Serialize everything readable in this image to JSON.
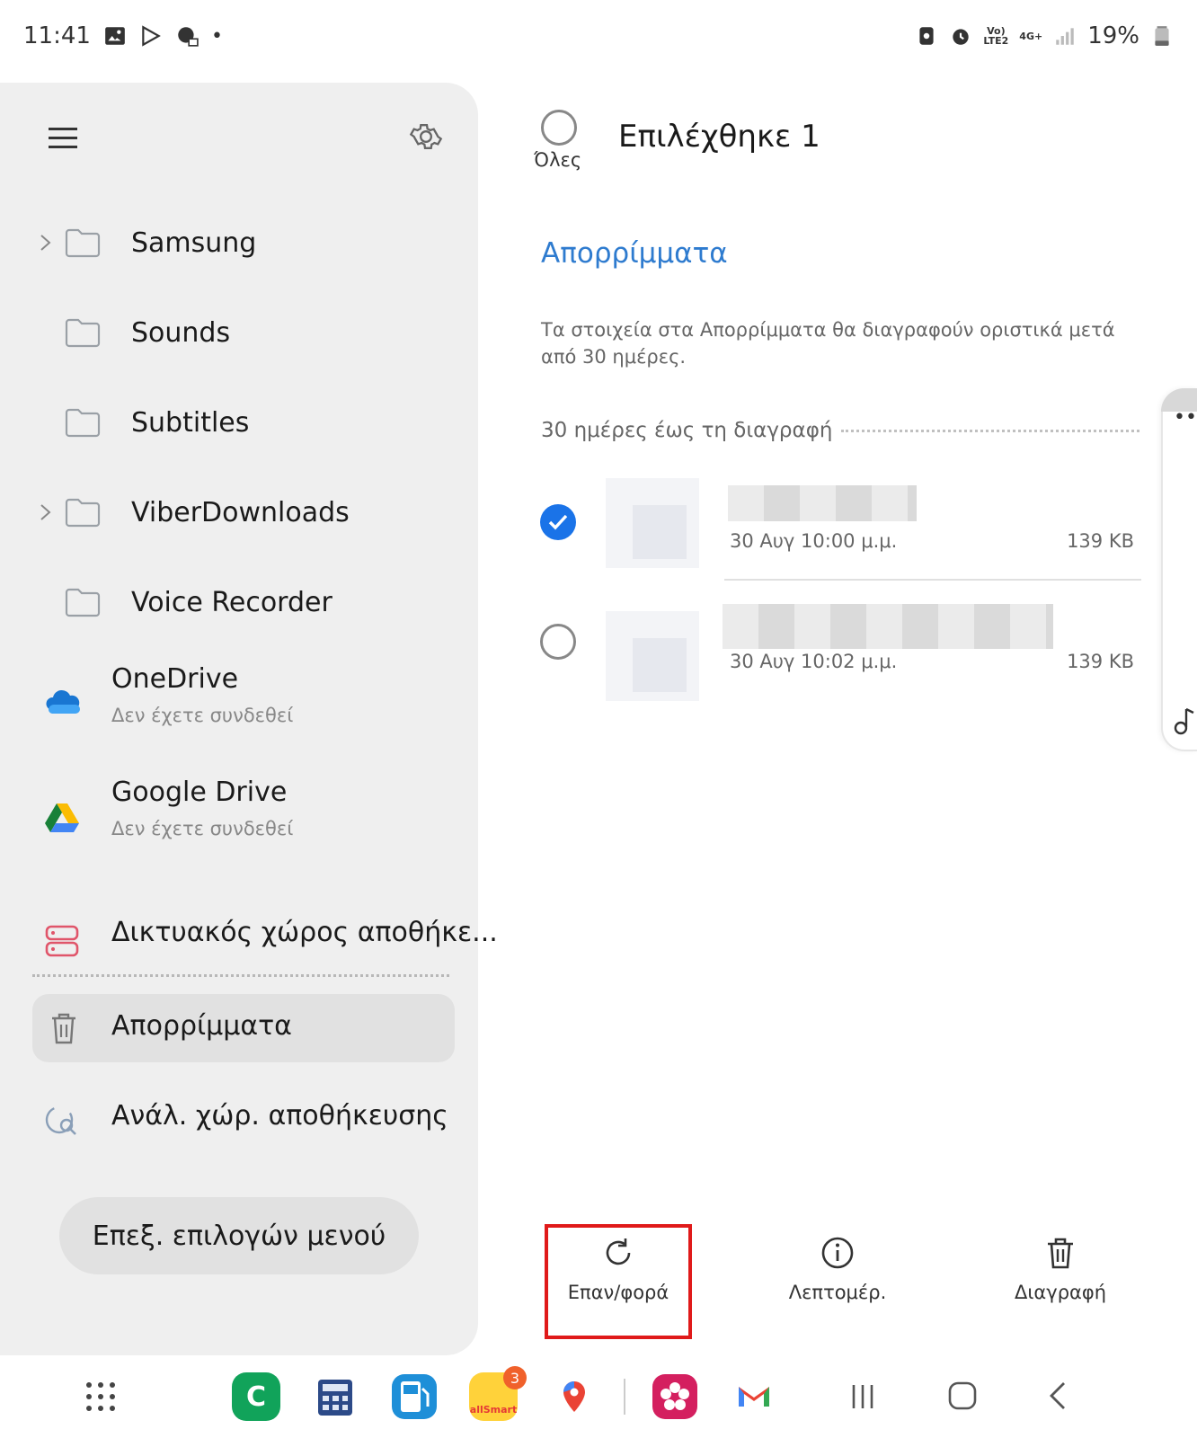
{
  "status_bar": {
    "time": "11:41",
    "battery": "19%",
    "net_top": "Vo)",
    "net_bottom": "LTE2",
    "net_gen": "4G+"
  },
  "sidebar": {
    "folders": [
      {
        "label": "Samsung",
        "expandable": true
      },
      {
        "label": "Sounds",
        "expandable": false
      },
      {
        "label": "Subtitles",
        "expandable": false
      },
      {
        "label": "ViberDownloads",
        "expandable": true
      },
      {
        "label": "Voice Recorder",
        "expandable": false
      }
    ],
    "services": [
      {
        "title": "OneDrive",
        "subtitle": "Δεν έχετε συνδεθεί"
      },
      {
        "title": "Google Drive",
        "subtitle": "Δεν έχετε συνδεθεί"
      },
      {
        "title": "Δικτυακός χώρος αποθήκε...",
        "subtitle": ""
      }
    ],
    "trash_label": "Απορρίμματα",
    "storage_label": "Ανάλ. χώρ. αποθήκευσης",
    "menu_button": "Επεξ. επιλογών μενού"
  },
  "main": {
    "select_all_label": "Όλες",
    "selected_count": "Επιλέχθηκε 1",
    "section_title": "Απορρίμματα",
    "note": "Τα στοιχεία στα Απορρίμματα θα διαγραφούν οριστικά μετά από 30 ημέρες.",
    "group_heading": "30 ημέρες έως τη διαγραφή",
    "items": [
      {
        "date": "30 Αυγ 10:00 μ.μ.",
        "size": "139 KB",
        "checked": true
      },
      {
        "date": "30 Αυγ 10:02 μ.μ.",
        "size": "139 KB",
        "checked": false
      }
    ]
  },
  "actions": {
    "restore": "Επαν/φορά",
    "details": "Λεπτομέρ.",
    "delete": "Διαγραφή"
  },
  "dock": {
    "allsmart_label": "allSmart",
    "allsmart_badge": "3"
  },
  "colors": {
    "accent": "#2e7bcf",
    "check": "#1a73e8",
    "highlight": "#e01a1a"
  }
}
